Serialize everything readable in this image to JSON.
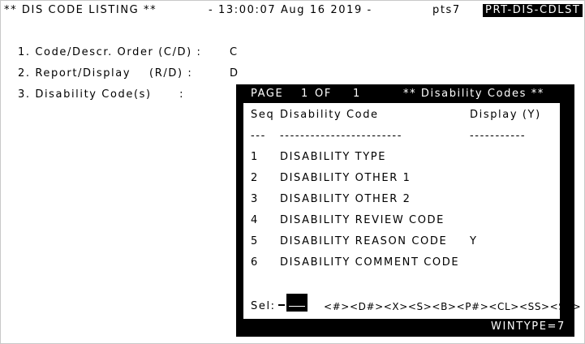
{
  "header": {
    "title": "** DIS CODE LISTING **",
    "time_info": "- 13:00:07 Aug 16 2019 -",
    "user": "pts7",
    "program": "PRT-DIS-CDLST"
  },
  "options": [
    {
      "label": "1. Code/Descr. Order (C/D) :",
      "value": "C"
    },
    {
      "label": "2. Report/Display    (R/D) :",
      "value": "D"
    },
    {
      "label": "3. Disability Code(s)      :",
      "value": ""
    }
  ],
  "window": {
    "page_label": "PAGE",
    "page_current": "1",
    "page_of": "OF",
    "page_total": "1",
    "title": "** Disability Codes **",
    "col_seq": "Seq",
    "col_code": "Disability Code",
    "col_display": "Display (Y)",
    "separator_seq": "---",
    "separator_code": "------------------------",
    "separator_display": "-----------",
    "rows": [
      {
        "seq": "1",
        "code": "DISABILITY TYPE",
        "display": ""
      },
      {
        "seq": "2",
        "code": "DISABILITY OTHER 1",
        "display": ""
      },
      {
        "seq": "3",
        "code": "DISABILITY OTHER 2",
        "display": ""
      },
      {
        "seq": "4",
        "code": "DISABILITY REVIEW CODE",
        "display": ""
      },
      {
        "seq": "5",
        "code": "DISABILITY REASON CODE",
        "display": "Y"
      },
      {
        "seq": "6",
        "code": "DISABILITY COMMENT CODE",
        "display": ""
      }
    ],
    "sel_label": "Sel:",
    "sel_value": "",
    "commands": "<#><D#><X><S><B><P#><CL><SS><SA>",
    "wintype": "WINTYPE=7"
  }
}
